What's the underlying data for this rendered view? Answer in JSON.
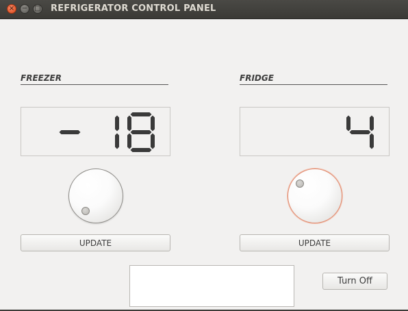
{
  "window": {
    "title": "REFRIGERATOR CONTROL PANEL",
    "controls": {
      "close": "×",
      "minimize": "−",
      "maximize": "□"
    }
  },
  "freezer": {
    "label": "FREEZER",
    "display_value": -18,
    "update_label": "UPDATE",
    "dial_focused": false
  },
  "fridge": {
    "label": "FRIDGE",
    "display_value": 4,
    "update_label": "UPDATE",
    "dial_focused": true
  },
  "message": "",
  "turn_off_label": "Turn Off",
  "colors": {
    "background": "#f2f1f0",
    "lcd_segment": "#3a3a3a",
    "focus_ring": "#e08a6e"
  }
}
